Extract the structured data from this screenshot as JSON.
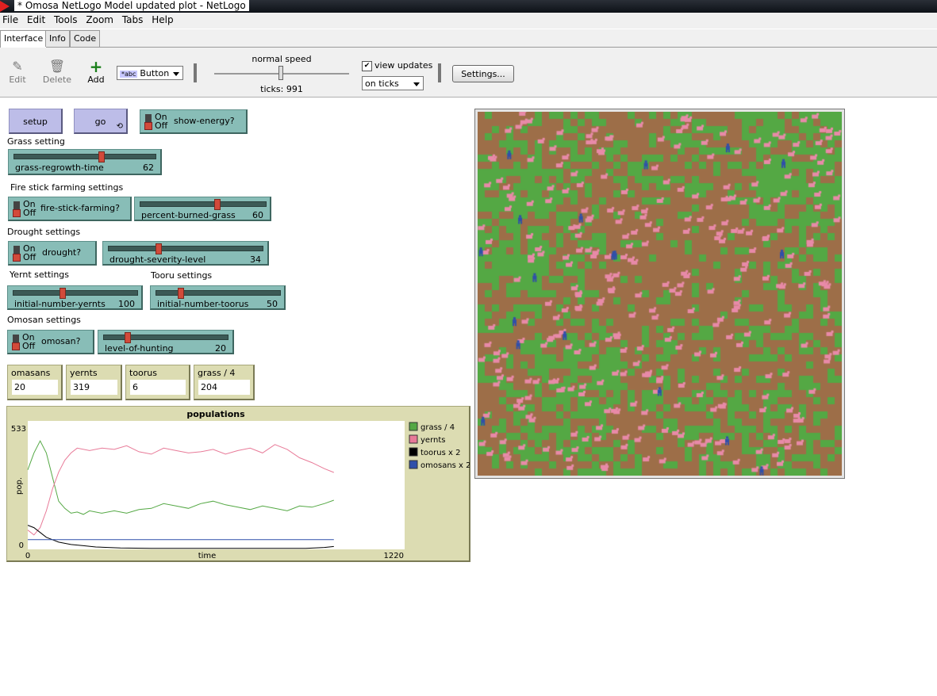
{
  "window": {
    "title": "* Omosa NetLogo Model updated plot - NetLogo"
  },
  "menu": [
    "File",
    "Edit",
    "Tools",
    "Zoom",
    "Tabs",
    "Help"
  ],
  "tabs": [
    {
      "label": "Interface",
      "active": true
    },
    {
      "label": "Info",
      "active": false
    },
    {
      "label": "Code",
      "active": false
    }
  ],
  "toolbar": {
    "edit": "Edit",
    "delete": "Delete",
    "add": "Add",
    "widget_type": "Button",
    "speed_label": "normal speed",
    "ticks": "ticks: 991",
    "view_updates_label": "view updates",
    "view_updates_checked": true,
    "update_mode": "on ticks",
    "settings": "Settings..."
  },
  "buttons": {
    "setup": "setup",
    "go": "go"
  },
  "switch_on": "On",
  "switch_off": "Off",
  "switches": {
    "show_energy": {
      "label": "show-energy?",
      "on": false
    },
    "fire_stick": {
      "label": "fire-stick-farming?",
      "on": false
    },
    "drought": {
      "label": "drought?",
      "on": false
    },
    "omosan": {
      "label": "omosan?",
      "on": false
    }
  },
  "section_labels": {
    "grass": "Grass setting",
    "fire": "Fire stick farming settings",
    "drought": "Drought settings",
    "yernt": "Yernt settings",
    "tooru": "Tooru settings",
    "omosan": "Omosan settings"
  },
  "sliders": {
    "grass_regrowth": {
      "label": "grass-regrowth-time",
      "value": "62",
      "fraction": 0.62
    },
    "percent_burned": {
      "label": "percent-burned-grass",
      "value": "60",
      "fraction": 0.6
    },
    "drought_severity": {
      "label": "drought-severity-level",
      "value": "34",
      "fraction": 0.34
    },
    "initial_yernts": {
      "label": "initial-number-yernts",
      "value": "100",
      "fraction": 0.33
    },
    "initial_toorus": {
      "label": "initial-number-toorus",
      "value": "50",
      "fraction": 0.2
    },
    "level_hunting": {
      "label": "level-of-hunting",
      "value": "20",
      "fraction": 0.2
    }
  },
  "monitors": [
    {
      "label": "omasans",
      "value": "20"
    },
    {
      "label": "yernts",
      "value": "319"
    },
    {
      "label": "toorus",
      "value": "6"
    },
    {
      "label": "grass / 4",
      "value": "204"
    }
  ],
  "colors": {
    "button": "#bdbde8",
    "widget": "#88bdb7",
    "monitor": "#dcdcb2",
    "grass": "#54a844",
    "soil": "#9d6e48",
    "yernt": "#e88aa8",
    "omosan": "#2f4faa"
  },
  "chart_data": {
    "type": "line",
    "title": "populations",
    "xlabel": "time",
    "ylabel": "pop.",
    "xlim": [
      0,
      1220
    ],
    "ylim": [
      0,
      533
    ],
    "x_tick_labels": [
      "0",
      "1220"
    ],
    "y_tick_labels": [
      "0",
      "533"
    ],
    "legend_position": "right",
    "series": [
      {
        "name": "grass / 4",
        "color": "#54a844",
        "x": [
          0,
          20,
          40,
          60,
          80,
          100,
          120,
          140,
          160,
          180,
          200,
          240,
          280,
          320,
          360,
          400,
          440,
          480,
          520,
          560,
          600,
          640,
          680,
          720,
          760,
          800,
          840,
          880,
          920,
          960,
          991
        ],
        "y": [
          330,
          400,
          450,
          400,
          300,
          200,
          170,
          150,
          155,
          145,
          160,
          150,
          160,
          150,
          165,
          170,
          190,
          180,
          170,
          190,
          200,
          185,
          175,
          165,
          180,
          170,
          160,
          180,
          175,
          190,
          204
        ]
      },
      {
        "name": "yernts",
        "color": "#e87a98",
        "x": [
          0,
          20,
          40,
          60,
          80,
          100,
          120,
          140,
          160,
          200,
          240,
          280,
          320,
          360,
          400,
          440,
          480,
          520,
          560,
          600,
          640,
          680,
          720,
          760,
          800,
          840,
          880,
          920,
          960,
          991
        ],
        "y": [
          80,
          60,
          90,
          160,
          250,
          320,
          370,
          400,
          420,
          410,
          420,
          415,
          430,
          405,
          395,
          420,
          410,
          400,
          405,
          415,
          395,
          410,
          420,
          400,
          435,
          415,
          380,
          360,
          335,
          319
        ]
      },
      {
        "name": "toorus x 2",
        "color": "#000000",
        "x": [
          0,
          20,
          40,
          60,
          80,
          100,
          140,
          180,
          220,
          260,
          300,
          400,
          500,
          600,
          700,
          800,
          900,
          960,
          991
        ],
        "y": [
          100,
          90,
          70,
          50,
          40,
          30,
          20,
          15,
          10,
          8,
          6,
          4,
          4,
          4,
          4,
          4,
          4,
          8,
          12
        ]
      },
      {
        "name": "omosans x 2",
        "color": "#2f4faa",
        "x": [
          0,
          991
        ],
        "y": [
          40,
          40
        ]
      }
    ]
  }
}
